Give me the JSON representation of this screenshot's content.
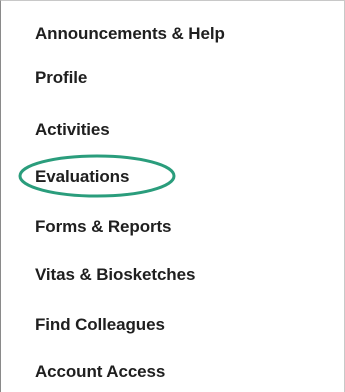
{
  "sidebar": {
    "items": [
      {
        "label": "Announcements & Help",
        "name": "sidebar-item-announcements-help"
      },
      {
        "label": "Profile",
        "name": "sidebar-item-profile"
      },
      {
        "label": "Activities",
        "name": "sidebar-item-activities"
      },
      {
        "label": "Evaluations",
        "name": "sidebar-item-evaluations"
      },
      {
        "label": "Forms & Reports",
        "name": "sidebar-item-forms-reports"
      },
      {
        "label": "Vitas & Biosketches",
        "name": "sidebar-item-vitas-biosketches"
      },
      {
        "label": "Find Colleagues",
        "name": "sidebar-item-find-colleagues"
      },
      {
        "label": "Account Access",
        "name": "sidebar-item-account-access"
      }
    ],
    "highlighted_item": "Evaluations",
    "highlight_color": "#2a9d7c"
  }
}
